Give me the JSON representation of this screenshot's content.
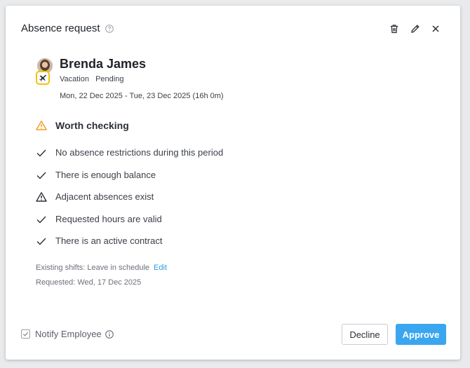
{
  "dialog": {
    "title": "Absence request"
  },
  "employee": {
    "name": "Brenda James",
    "type": "Vacation",
    "status": "Pending",
    "dates": "Mon, 22 Dec 2025 - Tue, 23 Dec 2025  (16h 0m)"
  },
  "warning": {
    "heading": "Worth checking"
  },
  "checks": [
    {
      "label": "No absence restrictions during this period",
      "icon": "check-icon"
    },
    {
      "label": "There is enough balance",
      "icon": "check-icon"
    },
    {
      "label": "Adjacent absences exist",
      "icon": "warning-icon"
    },
    {
      "label": "Requested hours are valid",
      "icon": "check-icon"
    },
    {
      "label": "There is an active contract",
      "icon": "check-icon"
    }
  ],
  "footer_info": {
    "shifts": "Existing shifts: Leave in schedule",
    "edit_label": "Edit",
    "requested": "Requested: Wed, 17 Dec 2025"
  },
  "actions": {
    "notify_label": "Notify Employee",
    "notify_checked": true,
    "decline_label": "Decline",
    "approve_label": "Approve"
  },
  "colors": {
    "accent": "#3aa6f0",
    "warning": "#f0a020",
    "badge_border": "#f2c400",
    "link": "#2b9be0"
  }
}
